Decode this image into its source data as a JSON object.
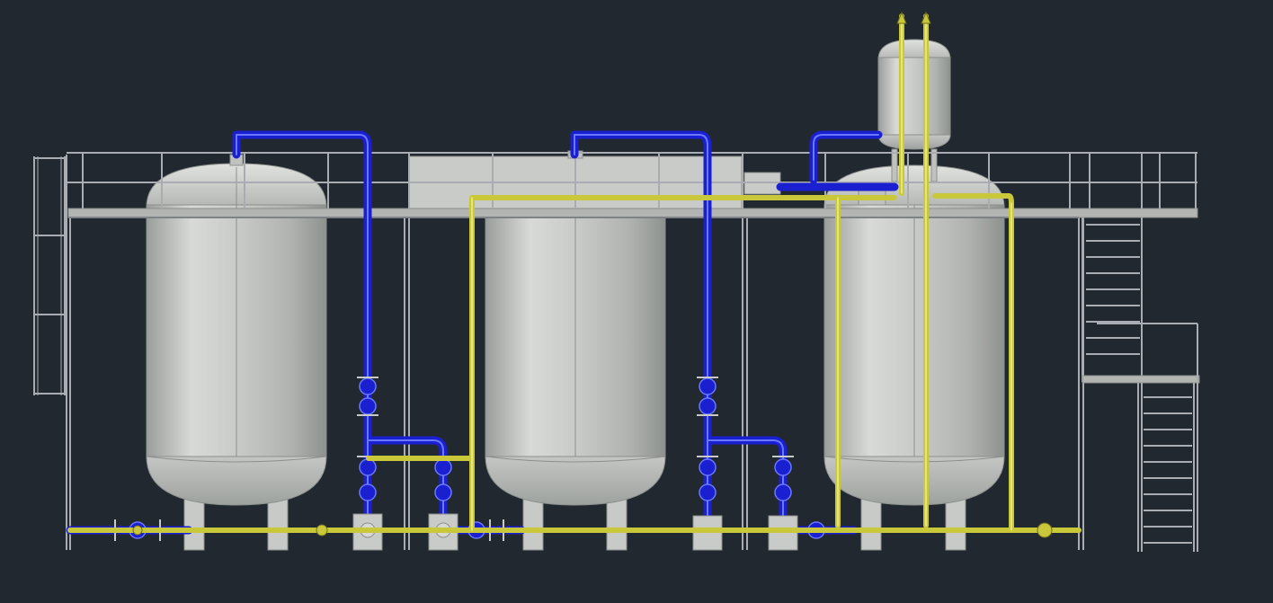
{
  "viewport": {
    "background": "#212830"
  },
  "palette": {
    "frame": "#a9adb1",
    "frame_dark": "#7d8286",
    "vessel_light": "#d6d8d6",
    "vessel_mid": "#b6b9b6",
    "vessel_dark": "#8c908d",
    "blue_pipe": "#1a1fd0",
    "blue_pipe_light": "#6a78ff",
    "yellow_pipe": "#c9c83a",
    "yellow_pipe_light": "#f0f08a",
    "valve_red": "#d04040"
  },
  "components": {
    "tanks": [
      "tank-1",
      "tank-2",
      "tank-3"
    ],
    "header_tank": "header-tank",
    "pumps": [
      "pump-1",
      "pump-2",
      "pump-3",
      "pump-4"
    ],
    "ladder": "ladder",
    "stairs": "stairs",
    "platform": "platform-walkway"
  }
}
